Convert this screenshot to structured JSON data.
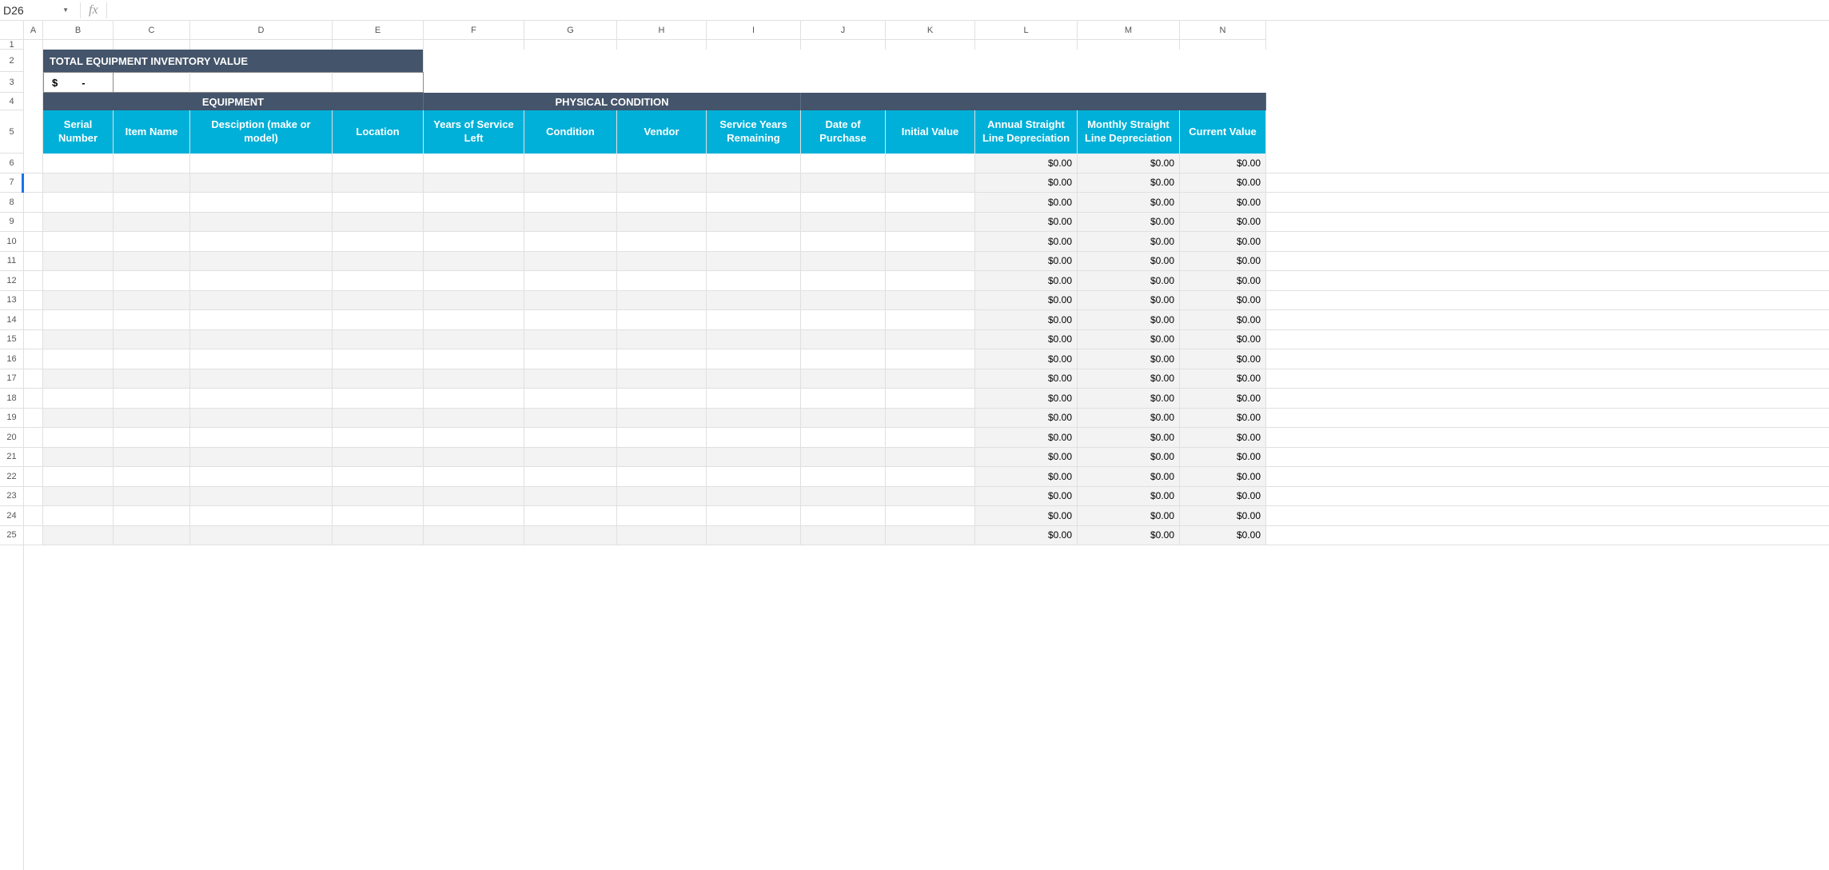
{
  "nameBox": "D26",
  "formulaBar": "",
  "fxLabel": "fx",
  "columns": [
    "A",
    "B",
    "C",
    "D",
    "E",
    "F",
    "G",
    "H",
    "I",
    "J",
    "K",
    "L",
    "M",
    "N"
  ],
  "rowNumbers": [
    1,
    2,
    3,
    4,
    5,
    6,
    7,
    8,
    9,
    10,
    11,
    12,
    13,
    14,
    15,
    16,
    17,
    18,
    19,
    20,
    21,
    22,
    23,
    24,
    25
  ],
  "titleHeader": "TOTAL EQUIPMENT INVENTORY VALUE",
  "totalValue": {
    "symbol": "$",
    "dash": "-"
  },
  "groupHeaders": {
    "equipment": "EQUIPMENT",
    "physical": "PHYSICAL CONDITION"
  },
  "columnTitles": {
    "serial": "Serial Number",
    "itemName": "Item Name",
    "description": "Desciption (make or model)",
    "location": "Location",
    "yearsService": "Years of Service Left",
    "condition": "Condition",
    "vendor": "Vendor",
    "serviceRemaining": "Service Years Remaining",
    "datePurchase": "Date of Purchase",
    "initialValue": "Initial Value",
    "annualDep": "Annual Straight Line Depreciation",
    "monthlyDep": "Monthly Straight Line Depreciation",
    "currentValue": "Current Value"
  },
  "zeroDollar": "$0.00",
  "dataRowCount": 20
}
